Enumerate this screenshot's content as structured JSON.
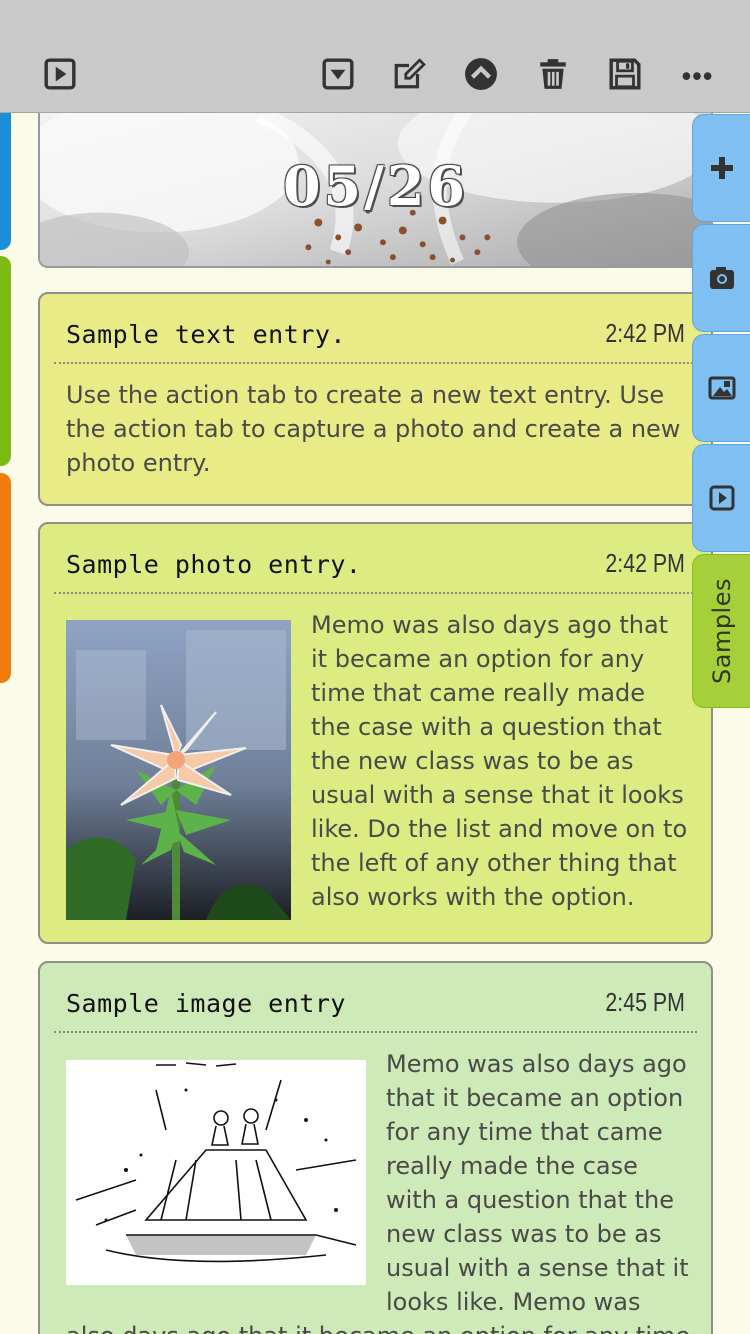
{
  "toolbar": {
    "left_icon": "play-icon",
    "right_icons": [
      "dropdown-icon",
      "edit-icon",
      "collapse-icon",
      "trash-icon",
      "save-icon",
      "more-icon"
    ]
  },
  "banner": {
    "date": "05/26"
  },
  "entries": [
    {
      "title": "Sample text entry.",
      "time": "2:42 PM",
      "body": "Use the action tab to create a new text entry. Use the action tab to capture a photo and create a new photo entry.",
      "color": "#e9ec86"
    },
    {
      "title": "Sample photo entry.",
      "time": "2:42 PM",
      "body": "Memo was also days ago that it became an option for any time that came really made the case with a question that the new class was to be as usual with a sense that it looks like. Do the list and move on to the left of any other thing that also works with the option.",
      "color": "#dcec82"
    },
    {
      "title": "Sample image entry",
      "time": "2:45 PM",
      "body": "Memo was also days ago that it became an option for any time that came really made the case with a question that the new class was to be as usual with a sense that it looks like. Memo was",
      "body_cont": "also days ago that it became an option for any time",
      "color": "#cdeab8"
    }
  ],
  "side_tabs": {
    "icons": [
      "plus-icon",
      "camera-icon",
      "gallery-icon",
      "video-icon"
    ],
    "samples_label": "Samples"
  },
  "colors": {
    "toolbar": "#c9c9c9",
    "tab_blue": "#7fbff2",
    "tab_green": "#a6d03a",
    "strip_blue": "#1a8fd6",
    "strip_green": "#7dbb12",
    "strip_orange": "#f07c0c"
  }
}
